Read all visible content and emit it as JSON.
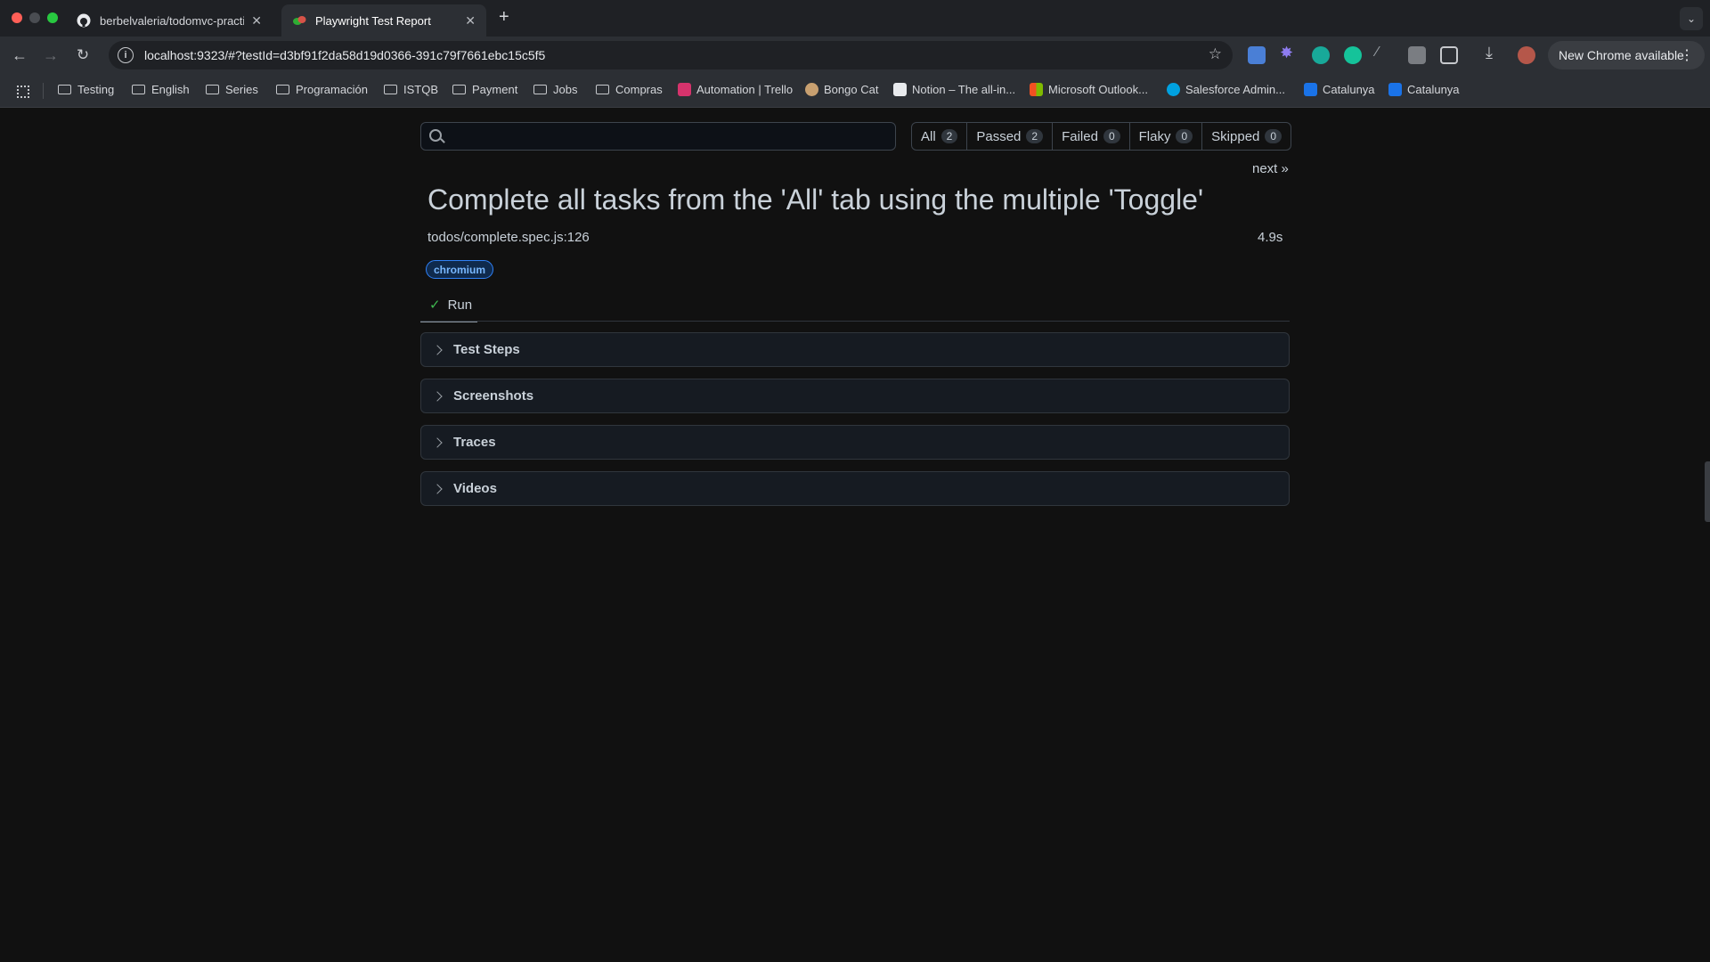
{
  "browser": {
    "tabs": [
      {
        "title": "berbelvaleria/todomvc-practi",
        "icon": "github-icon",
        "active": false
      },
      {
        "title": "Playwright Test Report",
        "icon": "playwright-icon",
        "active": true
      }
    ],
    "new_tab_symbol": "+",
    "url": "localhost:9323/#?testId=d3bf91f2da58d19d0366-391c79f7661ebc15c5f5",
    "new_chrome_label": "New Chrome available",
    "bookmarks": [
      {
        "label": "Testing",
        "type": "folder"
      },
      {
        "label": "English",
        "type": "folder"
      },
      {
        "label": "Series",
        "type": "folder"
      },
      {
        "label": "Programación",
        "type": "folder"
      },
      {
        "label": "ISTQB",
        "type": "folder"
      },
      {
        "label": "Payment",
        "type": "folder"
      },
      {
        "label": "Jobs",
        "type": "folder"
      },
      {
        "label": "Compras",
        "type": "folder"
      },
      {
        "label": "Automation | Trello",
        "type": "link",
        "color": "#d6336c"
      },
      {
        "label": "Bongo Cat",
        "type": "link",
        "color": "#c8a070"
      },
      {
        "label": "Notion – The all-in...",
        "type": "link",
        "color": "#e8eaed"
      },
      {
        "label": "Microsoft Outlook...",
        "type": "link",
        "color": "#f25022"
      },
      {
        "label": "Salesforce Admin...",
        "type": "link",
        "color": "#00a1e0"
      },
      {
        "label": "Catalunya",
        "type": "link",
        "color": "#1a73e8"
      },
      {
        "label": "Catalunya",
        "type": "link",
        "color": "#1a73e8"
      }
    ]
  },
  "report": {
    "search_placeholder": "",
    "filters": [
      {
        "label": "All",
        "count": "2"
      },
      {
        "label": "Passed",
        "count": "2"
      },
      {
        "label": "Failed",
        "count": "0"
      },
      {
        "label": "Flaky",
        "count": "0"
      },
      {
        "label": "Skipped",
        "count": "0"
      }
    ],
    "next_link": "next »",
    "test_title": "Complete all tasks from the 'All' tab using the multiple 'Toggle'",
    "location": "todos/complete.spec.js:126",
    "duration": "4.9s",
    "project": "chromium",
    "run_tab": {
      "label": "Run",
      "status_icon": "check-icon"
    },
    "sections": [
      {
        "label": "Test Steps"
      },
      {
        "label": "Screenshots"
      },
      {
        "label": "Traces"
      },
      {
        "label": "Videos"
      }
    ]
  },
  "colors": {
    "page_bg": "#111111",
    "passed": "#3fb950",
    "project_badge": "#2f81f7"
  }
}
